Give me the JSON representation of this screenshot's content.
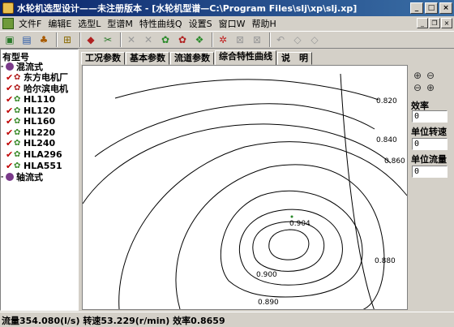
{
  "window": {
    "title": "水轮机选型设计——未注册版本 - [水轮机型谱—C:\\Program Files\\slj\\xp\\slj.xp]",
    "min_label": "_",
    "max_label": "□",
    "close_label": "×"
  },
  "menu": {
    "items": [
      "文件F",
      "编辑E",
      "选型L",
      "型谱M",
      "特性曲线Q",
      "设置S",
      "窗口W",
      "帮助H"
    ]
  },
  "mdi": {
    "min_label": "_",
    "restore_label": "❐",
    "close_label": "×"
  },
  "toolbar": {
    "buttons": [
      "open-icon",
      "save-icon",
      "tree-icon",
      "print-icon",
      "back-icon",
      "cut-icon",
      "copy-icon",
      "paste-icon",
      "turbine-icon",
      "turbine2-icon",
      "grid-icon",
      "delete-icon",
      "close-icon",
      "doc-icon",
      "undo-icon",
      "redo-icon"
    ]
  },
  "sidebar": {
    "header": "有型号",
    "groups": [
      {
        "label": "混流式"
      },
      {
        "label": "轴流式"
      }
    ],
    "manufacturers": [
      "东方电机厂",
      "哈尔滨电机"
    ],
    "models": [
      "HL110",
      "HL120",
      "HL160",
      "HL220",
      "HL240",
      "HLA296",
      "HLA551"
    ]
  },
  "tabs": [
    "工况参数",
    "基本参数",
    "流道参数",
    "综合特性曲线",
    "说　明"
  ],
  "active_tab": 3,
  "contours": {
    "labels": [
      "0.820",
      "0.840",
      "0.860",
      "0.880",
      "0.890",
      "0.900",
      "0.904"
    ]
  },
  "right_panel": {
    "efficiency_label": "效率",
    "efficiency_value": "0",
    "unit_speed_label": "单位转速",
    "unit_speed_value": "0",
    "unit_flow_label": "单位流量",
    "unit_flow_value": "0"
  },
  "status": {
    "text": "流量354.080(l/s) 转速53.229(r/min) 效率0.8659"
  }
}
